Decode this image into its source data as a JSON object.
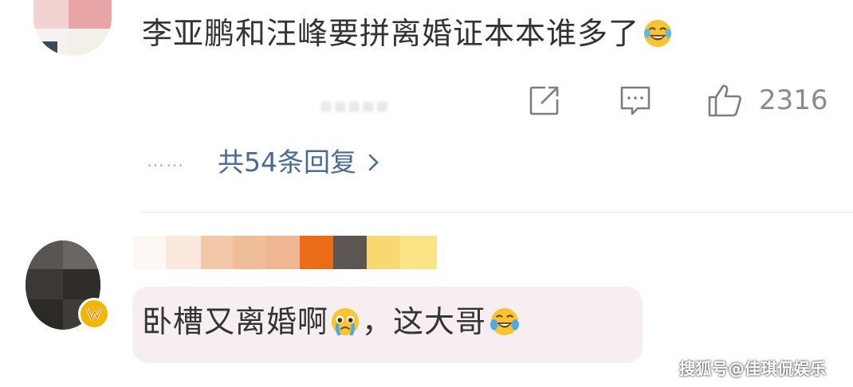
{
  "comment_1": {
    "text": "李亚鹏和汪峰要拼离婚证本本谁多了",
    "emoji": "laughing-tears-emoji",
    "like_count": "2316",
    "replies_label": "共54条回复",
    "replies_dots": "……",
    "icons": [
      "share-icon",
      "comment-icon",
      "thumbs-up-icon",
      "chevron-right-icon"
    ]
  },
  "comment_2": {
    "text_part1": "卧槽又离婚啊",
    "text_part2": "，这大哥",
    "emojis": [
      "pleading-teary-emoji",
      "laughing-tears-emoji"
    ],
    "badge_icon": "vip-badge-icon"
  },
  "watermark": "搜狐号@佳琪侃娱乐",
  "colors": {
    "reply_link": "#4a6a95",
    "meta_gray": "#8a8a8a",
    "bubble_bg": "#f6eef1",
    "badge": "#f2b705"
  }
}
